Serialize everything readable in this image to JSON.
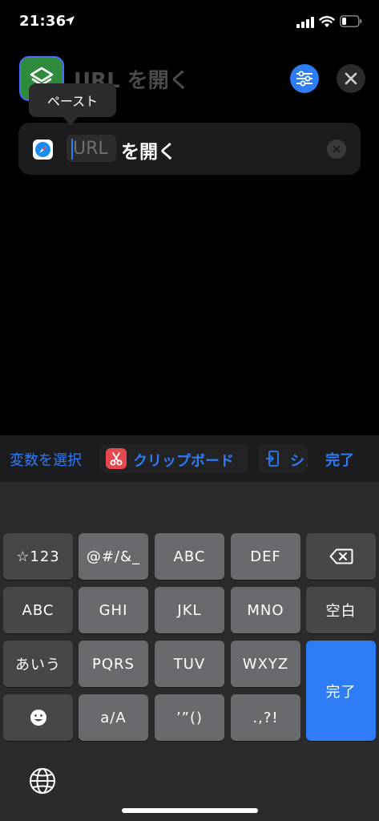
{
  "status_bar": {
    "time": "21:36",
    "location_icon": "location-arrow-icon",
    "signal_icon": "cellular-signal-icon",
    "wifi_icon": "wifi-icon",
    "battery_icon": "battery-icon"
  },
  "header": {
    "app_icon": "shortcuts-app-icon",
    "title": "URL を開く",
    "settings_icon": "sliders-icon",
    "close_icon": "close-icon"
  },
  "tooltip": {
    "label": "ペースト"
  },
  "action": {
    "app_icon": "safari-icon",
    "url_placeholder": "URL",
    "text": "を開く",
    "clear_icon": "clear-circle-icon"
  },
  "variable_bar": {
    "select_label": "変数を選択",
    "clipboard_label": "クリップボード",
    "clipboard_icon": "scissors-icon",
    "shortcut_label": "ショ",
    "shortcut_icon": "shortcut-input-icon",
    "done_label": "完了"
  },
  "keyboard": {
    "rows": [
      [
        "☆123",
        "@#/&_",
        "ABC",
        "DEF",
        "⌫"
      ],
      [
        "ABC",
        "GHI",
        "JKL",
        "MNO",
        "空白"
      ],
      [
        "あいう",
        "PQRS",
        "TUV",
        "WXYZ",
        "完了"
      ],
      [
        "☺",
        "a/A",
        "’”()",
        ".,?!"
      ]
    ],
    "emoji_icon": "emoji-icon",
    "delete_icon": "delete-icon",
    "globe_icon": "globe-icon"
  },
  "colors": {
    "accent": "#2e7cf6",
    "background": "#000000",
    "card": "#1c1c1e",
    "key": "#6a6a6e",
    "key_dark": "#474749",
    "clipboard_red": "#e5484d"
  }
}
